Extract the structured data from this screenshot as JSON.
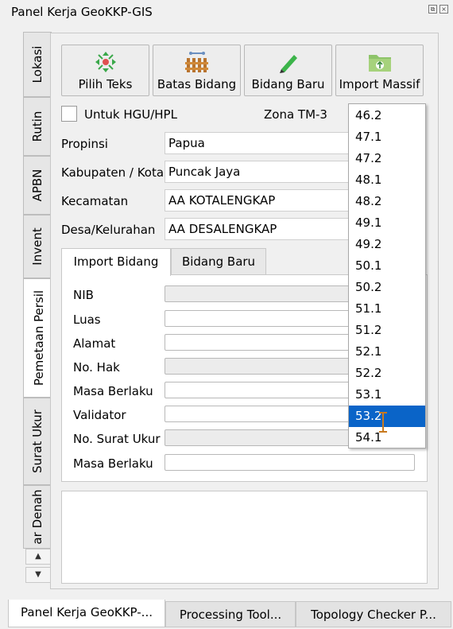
{
  "window": {
    "title": "Panel Kerja GeoKKP-GIS"
  },
  "side_tabs": [
    "Lokasi",
    "Rutin",
    "APBN",
    "Invent",
    "Pemetaan Persil",
    "Surat Ukur",
    "ar Denah"
  ],
  "toolbar": {
    "pilih_teks": "Pilih Teks",
    "batas_bidang": "Batas Bidang",
    "bidang_baru": "Bidang Baru",
    "import_massif": "Import Massif"
  },
  "hgu_checkbox_label": "Untuk HGU/HPL",
  "zona_label": "Zona TM-3",
  "location": {
    "propinsi_label": "Propinsi",
    "propinsi_value": "Papua",
    "kabupaten_label": "Kabupaten / Kota",
    "kabupaten_value": "Puncak Jaya",
    "kecamatan_label": "Kecamatan",
    "kecamatan_value": "AA KOTALENGKAP",
    "desa_label": "Desa/Kelurahan",
    "desa_value": "AA DESALENGKAP"
  },
  "inner_tabs": {
    "import_bidang": "Import Bidang",
    "bidang_baru": "Bidang Baru"
  },
  "form": {
    "nib": "NIB",
    "luas": "Luas",
    "alamat": "Alamat",
    "no_hak": "No. Hak",
    "masa_berlaku": "Masa Berlaku",
    "validator": "Validator",
    "no_surat_ukur": "No. Surat Ukur",
    "masa_berlaku_2": "Masa Berlaku"
  },
  "zona_options": [
    "46.2",
    "47.1",
    "47.2",
    "48.1",
    "48.2",
    "49.1",
    "49.2",
    "50.1",
    "50.2",
    "51.1",
    "51.2",
    "52.1",
    "52.2",
    "53.1",
    "53.2",
    "54.1"
  ],
  "zona_selected": "53.2",
  "dock_tabs": [
    "Panel Kerja GeoKKP-...",
    "Processing Tool...",
    "Topology Checker P..."
  ],
  "colors": {
    "selection": "#0a64c8"
  }
}
